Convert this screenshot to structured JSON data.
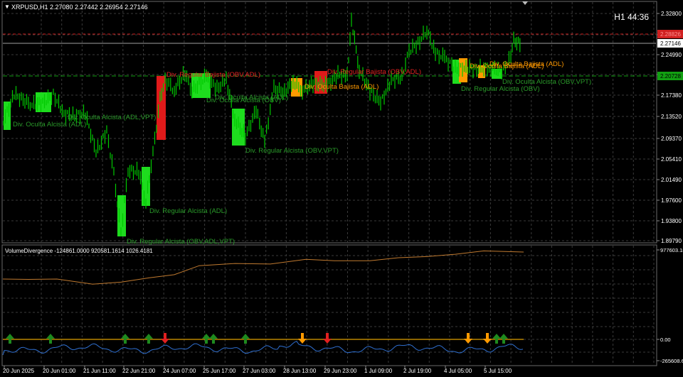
{
  "main_chart": {
    "menu_glyph": "▼",
    "title": "XRPUSD,H1  2.27080 2.27442 2.26954 2.27146",
    "timer": "H1  44:36",
    "price_axis": [
      "2.32800",
      "2.28800",
      "2.24990",
      "2.21180",
      "2.17380",
      "2.13520",
      "2.09370",
      "2.05410",
      "2.01490",
      "1.97600",
      "1.93800",
      "1.89790"
    ],
    "price_tags": [
      {
        "text": "2.28826",
        "bg": "#d02020",
        "fg": "#ff9090"
      },
      {
        "text": "2.27146",
        "bg": "#ffffff",
        "fg": "#000000"
      },
      {
        "text": "2.20728",
        "bg": "#12a012",
        "fg": "#000000"
      }
    ],
    "annotations": [
      {
        "text": "Div. Oculta Alcista (ADL,VPT)",
        "color": "#2a9a2a"
      },
      {
        "text": "Div. Oculta Alcista (ADL)",
        "color": "#2a9a2a"
      },
      {
        "text": "Div. Regular Bajista (OBV,ADL)",
        "color": "#e02020"
      },
      {
        "text": "Div. Oculta Alcista (OBV)",
        "color": "#2a9a2a"
      },
      {
        "text": "Div. Oculta Alcista (ADL)",
        "color": "#2a9a2a"
      },
      {
        "text": "Div. Regular Alcista (OBV,VPT)",
        "color": "#2a9a2a"
      },
      {
        "text": "Div. Regular Alcista (ADL)",
        "color": "#2a9a2a"
      },
      {
        "text": "Div. Regular Alcista (OBV,ADL,VPT)",
        "color": "#2a9a2a"
      },
      {
        "text": "Div. Regular Bajista (OBV,ADL)",
        "color": "#e02020"
      },
      {
        "text": "Div. Oculta Bajista (ADL)",
        "color": "#ff9900"
      },
      {
        "text": "Div. Oculta Bajista (ADL)",
        "color": "#ff9900"
      },
      {
        "text": "Div. Oculta Bajista (ADL)",
        "color": "#ff9900"
      },
      {
        "text": "Div. Regular Alcista (OBV)",
        "color": "#2a9a2a"
      },
      {
        "text": "Div. Oculta Alcista (OBV,VPT)",
        "color": "#2a9a2a"
      }
    ]
  },
  "sub_window": {
    "title": "VolumeDivergence -124861.0000 920581.1614 1026.4181",
    "axis": [
      "977603.18",
      "0.00",
      "-265608.62"
    ]
  },
  "time_axis": [
    "20 Jun 2025",
    "20 Jun 01:00",
    "21 Jun 11:00",
    "22 Jun 21:00",
    "24 Jun 07:00",
    "25 Jun 17:00",
    "27 Jun 03:00",
    "28 Jun 13:00",
    "29 Jun 23:00",
    "1 Jul 09:00",
    "2 Jul 19:00",
    "4 Jul 05:00",
    "5 Jul 15:00"
  ],
  "colors": {
    "background": "#000000",
    "grid": "#3a3a3a",
    "candle": "#00c800",
    "bull_zone": "#1edc1e",
    "bear_zone": "#e01a1a",
    "hidden_bear_zone": "#ff9a00",
    "obv_line": "#c07a30",
    "vpt_line": "#2f6fd0",
    "signal_line": "#e0a000",
    "arrow_up": "#1e8a1e",
    "arrow_down_red": "#e02020",
    "arrow_down_orange": "#ff9a00"
  },
  "signal_arrows": [
    "up",
    "up",
    "up",
    "up",
    "down-red",
    "up",
    "up",
    "up",
    "down-orange",
    "down-red",
    "down-orange",
    "down-orange",
    "up",
    "up"
  ]
}
